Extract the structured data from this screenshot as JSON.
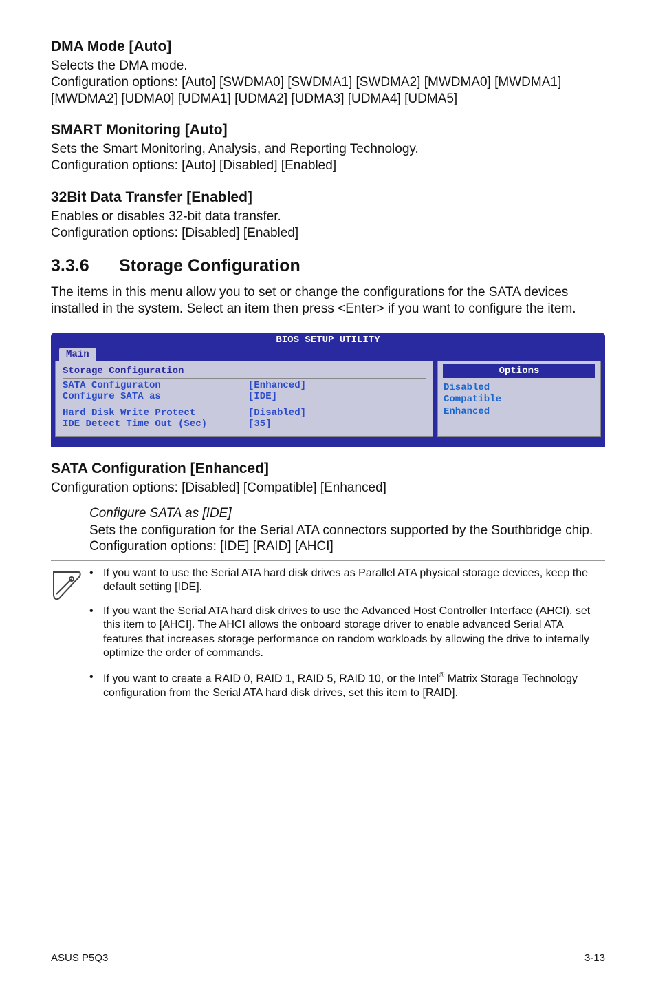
{
  "s1": {
    "title": "DMA Mode [Auto]",
    "p1": "Selects the DMA mode.",
    "p2": "Configuration options: [Auto] [SWDMA0] [SWDMA1] [SWDMA2] [MWDMA0] [MWDMA1] [MWDMA2] [UDMA0] [UDMA1] [UDMA2] [UDMA3] [UDMA4] [UDMA5]"
  },
  "s2": {
    "title": "SMART Monitoring [Auto]",
    "p1": "Sets the Smart Monitoring, Analysis, and Reporting Technology.",
    "p2": "Configuration options: [Auto] [Disabled] [Enabled]"
  },
  "s3": {
    "title": "32Bit Data Transfer [Enabled]",
    "p1": "Enables or disables 32-bit data transfer.",
    "p2": "Configuration options: [Disabled] [Enabled]"
  },
  "h336": {
    "num": "3.3.6",
    "title": "Storage Configuration",
    "p": "The items in this menu allow you to set or change the configurations for the SATA devices installed in the system. Select an item then press <Enter> if you want to configure the item."
  },
  "bios": {
    "util": "BIOS SETUP UTILITY",
    "tab": "Main",
    "panel_title": "Storage Configuration",
    "rows": [
      {
        "lbl": "SATA Configuraton",
        "val": "[Enhanced]"
      },
      {
        "lbl": " Configure SATA as",
        "val": "[IDE]"
      },
      {
        "lbl": "Hard Disk Write Protect",
        "val": "[Disabled]"
      },
      {
        "lbl": "IDE Detect Time Out (Sec)",
        "val": "[35]"
      }
    ],
    "options_title": "Options",
    "options": [
      "Disabled",
      "Compatible",
      "Enhanced"
    ]
  },
  "s4": {
    "title": "SATA Configuration [Enhanced]",
    "p": "Configuration options: [Disabled] [Compatible] [Enhanced]"
  },
  "sub": {
    "title": "Configure SATA as [IDE]",
    "p": "Sets the configuration for the Serial ATA connectors supported by the Southbridge chip. Configuration options: [IDE] [RAID] [AHCI]"
  },
  "notes": {
    "b1": "If you want to use the Serial ATA hard disk drives as Parallel ATA physical storage devices, keep the default setting [IDE].",
    "b2": "If you want the Serial ATA hard disk drives to use the Advanced Host Controller Interface (AHCI), set this item to [AHCI]. The AHCI allows the onboard storage driver to enable advanced Serial ATA features that increases storage performance on random workloads by allowing the drive to internally optimize the order of commands.",
    "b3a": "If you want to create a RAID 0, RAID 1, RAID 5, RAID 10, or the Intel",
    "b3b": " Matrix Storage Technology configuration from the Serial ATA hard disk drives, set this item to [RAID]."
  },
  "footer": {
    "left": "ASUS P5Q3",
    "right": "3-13"
  }
}
